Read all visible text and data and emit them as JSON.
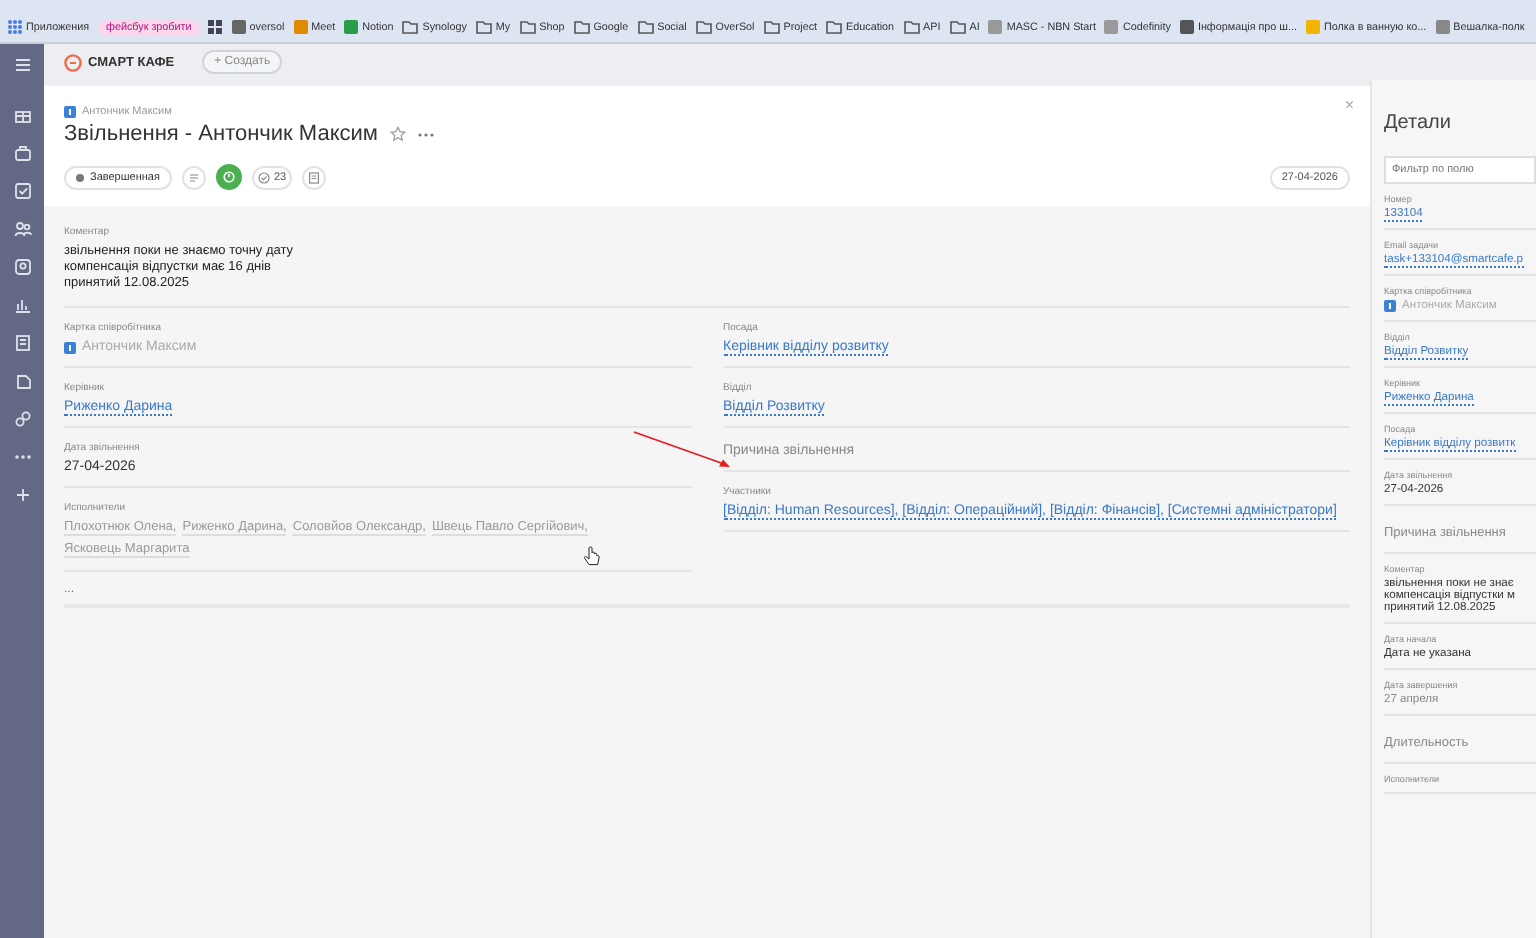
{
  "bookmarks": [
    {
      "label": "Приложения",
      "kind": "apps"
    },
    {
      "label": "фейсбук зробити",
      "kind": "badge"
    },
    {
      "kind": "grid"
    },
    {
      "label": "oversol",
      "kind": "site"
    },
    {
      "label": "Meet",
      "kind": "site"
    },
    {
      "label": "Notion",
      "kind": "site"
    },
    {
      "label": "Synology",
      "kind": "folder"
    },
    {
      "label": "My",
      "kind": "folder"
    },
    {
      "label": "Shop",
      "kind": "folder"
    },
    {
      "label": "Google",
      "kind": "folder"
    },
    {
      "label": "Social",
      "kind": "folder"
    },
    {
      "label": "OverSol",
      "kind": "folder"
    },
    {
      "label": "Project",
      "kind": "folder"
    },
    {
      "label": "Education",
      "kind": "folder"
    },
    {
      "label": "API",
      "kind": "folder"
    },
    {
      "label": "AI",
      "kind": "folder"
    },
    {
      "label": "MASC - NBN Start",
      "kind": "site"
    },
    {
      "label": "Codefinity",
      "kind": "site"
    },
    {
      "label": "Інформація про ш...",
      "kind": "site"
    },
    {
      "label": "Полка в ванную ко...",
      "kind": "site"
    },
    {
      "label": "Вешалка-полк",
      "kind": "site"
    }
  ],
  "header": {
    "logo": "СМАРТ КАФЕ",
    "create_button": "+ Создать"
  },
  "task": {
    "close": "×",
    "breadcrumb": "Антончик Максим",
    "title": "Звільнення - Антончик Максим",
    "status": "Завершенная",
    "comments_count": "23",
    "date": "27-04-2026",
    "comment": {
      "label": "Коментар",
      "lines": [
        "звільнення поки не знаємо точну дату",
        "компенсація відпустки має 16 днів",
        "принятий 12.08.2025"
      ]
    },
    "fields_left": [
      {
        "label": "Картка співробітника",
        "value": "Антончик Максим",
        "kind": "employee"
      },
      {
        "label": "Керівник",
        "value": "Риженко Дарина",
        "kind": "link"
      },
      {
        "label": "Дата звільнення",
        "value": "27-04-2026",
        "kind": "text"
      },
      {
        "label": "Исполнители",
        "values": [
          "Плохотнюк Олена,",
          "Риженко Дарина,",
          "Соловйов Олександр,",
          "Швець Павло Сергійович,",
          "Ясковець Маргарита"
        ],
        "kind": "people"
      }
    ],
    "fields_right": [
      {
        "label": "Посада",
        "value": "Керівник відділу розвитку",
        "kind": "link"
      },
      {
        "label": "Відділ",
        "value": "Відділ Розвитку",
        "kind": "link"
      },
      {
        "label": "Причина звільнення",
        "kind": "section"
      },
      {
        "label": "Участники",
        "value": "[Відділ: Human Resources], [Відділ: Операційний], [Відділ: Фінансів], [Системні адміністратори]",
        "kind": "link"
      }
    ],
    "more": "..."
  },
  "details": {
    "title": "Детали",
    "filter_placeholder": "Фильтр по полю",
    "items": [
      {
        "label": "Номер",
        "value": "133104",
        "kind": "link"
      },
      {
        "label": "Email задачи",
        "value": "task+133104@smartcafe.p",
        "kind": "link"
      },
      {
        "label": "Картка співробітника",
        "value": "Антончик Максим",
        "kind": "employee"
      },
      {
        "label": "Відділ",
        "value": "Відділ Розвитку",
        "kind": "link"
      },
      {
        "label": "Керівник",
        "value": "Риженко Дарина",
        "kind": "link"
      },
      {
        "label": "Посада",
        "value": "Керівник відділу розвитк",
        "kind": "link"
      },
      {
        "label": "Дата звільнення",
        "value": "27-04-2026",
        "kind": "text"
      },
      {
        "label": "Причина звільнення",
        "kind": "section"
      },
      {
        "label": "Коментар",
        "lines": [
          "звільнення поки не знає",
          "компенсація відпустки м",
          "принятий 12.08.2025"
        ],
        "kind": "lines"
      },
      {
        "label": "Дата начала",
        "value": "Дата не указана",
        "kind": "text"
      },
      {
        "label": "Дата завершения",
        "value": "27 апреля",
        "kind": "muted"
      },
      {
        "label": "Длительность",
        "kind": "section"
      },
      {
        "label": "Исполнители",
        "kind": "label"
      }
    ]
  }
}
